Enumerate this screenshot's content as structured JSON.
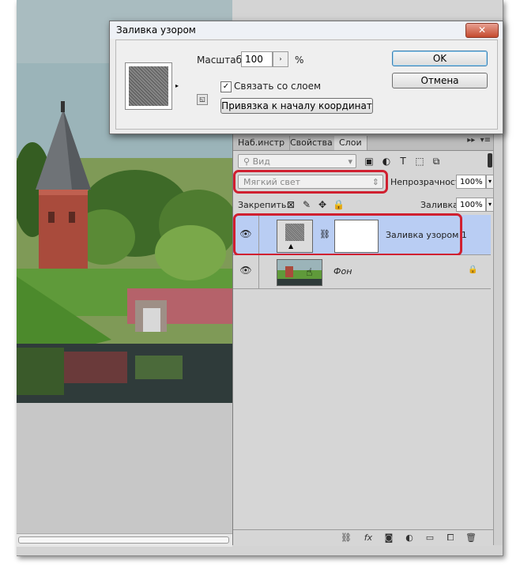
{
  "dialog": {
    "title": "Заливка узором",
    "close_symbol": "✕",
    "scale_label": "Масштаб:",
    "scale_value": "100",
    "scale_unit": "%",
    "link_label": "Связать со слоем",
    "link_checked": true,
    "snap_button": "Привязка к началу координат",
    "ok_button": "OK",
    "cancel_button": "Отмена"
  },
  "panel": {
    "tabs": [
      "Наб.инстр",
      "Свойства",
      "Слои"
    ],
    "active_tab": "Слои",
    "filter_label": "Вид",
    "blend_mode": "Мягкий свет",
    "opacity_label": "Непрозрачность:",
    "opacity_value": "100%",
    "lock_label": "Закрепить:",
    "fill_label": "Заливка:",
    "fill_value": "100%",
    "layers": [
      {
        "name": "Заливка узором 1",
        "selected": true
      },
      {
        "name": "Фон",
        "selected": false
      }
    ]
  },
  "colors": {
    "highlight_box": "#d02030",
    "selected_layer": "#b9cdf3",
    "panel_bg": "#d6d6d6"
  }
}
